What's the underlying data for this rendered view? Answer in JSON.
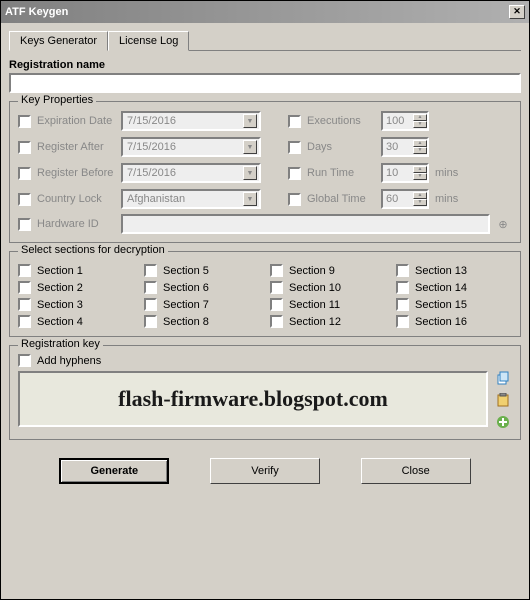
{
  "window": {
    "title": "ATF Keygen"
  },
  "tabs": [
    {
      "label": "Keys Generator",
      "active": true
    },
    {
      "label": "License Log",
      "active": false
    }
  ],
  "registration": {
    "label": "Registration name",
    "value": ""
  },
  "keyProperties": {
    "title": "Key Properties",
    "expirationDate": {
      "label": "Expiration Date",
      "value": "7/15/2016"
    },
    "registerAfter": {
      "label": "Register After",
      "value": "7/15/2016"
    },
    "registerBefore": {
      "label": "Register Before",
      "value": "7/15/2016"
    },
    "countryLock": {
      "label": "Country Lock",
      "value": "Afghanistan"
    },
    "hardwareId": {
      "label": "Hardware ID",
      "value": ""
    },
    "executions": {
      "label": "Executions",
      "value": "100"
    },
    "days": {
      "label": "Days",
      "value": "30"
    },
    "runTime": {
      "label": "Run Time",
      "value": "10",
      "unit": "mins"
    },
    "globalTime": {
      "label": "Global Time",
      "value": "60",
      "unit": "mins"
    }
  },
  "sections": {
    "title": "Select sections for decryption",
    "items": [
      "Section 1",
      "Section 2",
      "Section 3",
      "Section 4",
      "Section 5",
      "Section 6",
      "Section 7",
      "Section 8",
      "Section 9",
      "Section 10",
      "Section 11",
      "Section 12",
      "Section 13",
      "Section 14",
      "Section 15",
      "Section 16"
    ]
  },
  "regKey": {
    "title": "Registration key",
    "addHyphens": "Add hyphens",
    "content": "flash-firmware.blogspot.com"
  },
  "buttons": {
    "generate": "Generate",
    "verify": "Verify",
    "close": "Close"
  }
}
